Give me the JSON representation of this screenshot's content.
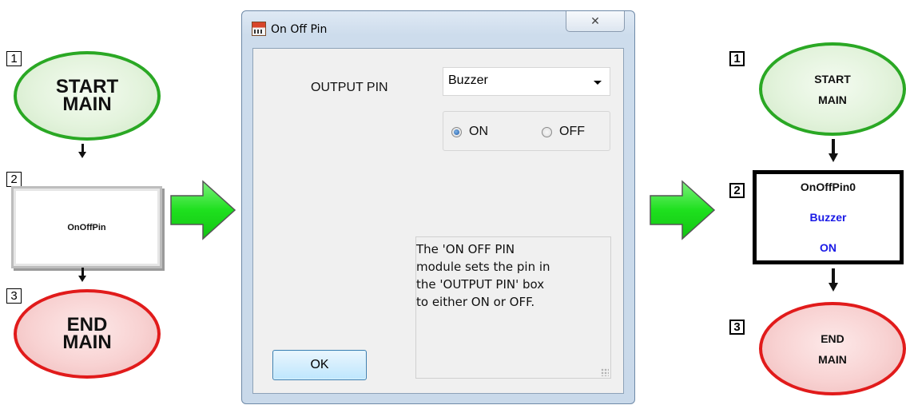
{
  "left_flowchart": {
    "step1_number": "1",
    "step1_label_line1": "START",
    "step1_label_line2": "MAIN",
    "step2_number": "2",
    "step2_label": "OnOffPin",
    "step3_number": "3",
    "step3_label_line1": "END",
    "step3_label_line2": "MAIN"
  },
  "dialog": {
    "title": "On Off Pin",
    "close_label": "✕",
    "output_pin_label": "OUTPUT PIN",
    "output_pin_value": "Buzzer",
    "radio_on_label": "ON",
    "radio_off_label": "OFF",
    "radio_selected": "ON",
    "help_text": "The 'ON OFF PIN\nmodule sets the pin in\nthe 'OUTPUT PIN' box\nto either ON or OFF.",
    "ok_label": "OK"
  },
  "right_flowchart": {
    "step1_number": "1",
    "step1_label_line1": "START",
    "step1_label_line2": "MAIN",
    "step2_number": "2",
    "step2_line1": "OnOffPin0",
    "step2_line2": "Buzzer",
    "step2_line3": "ON",
    "step3_number": "3",
    "step3_label_line1": "END",
    "step3_label_line2": "MAIN"
  },
  "colors": {
    "start_border": "#2aa824",
    "end_border": "#e11b1b",
    "green_arrow": "#22e022",
    "blue_text": "#1a1ae6"
  }
}
